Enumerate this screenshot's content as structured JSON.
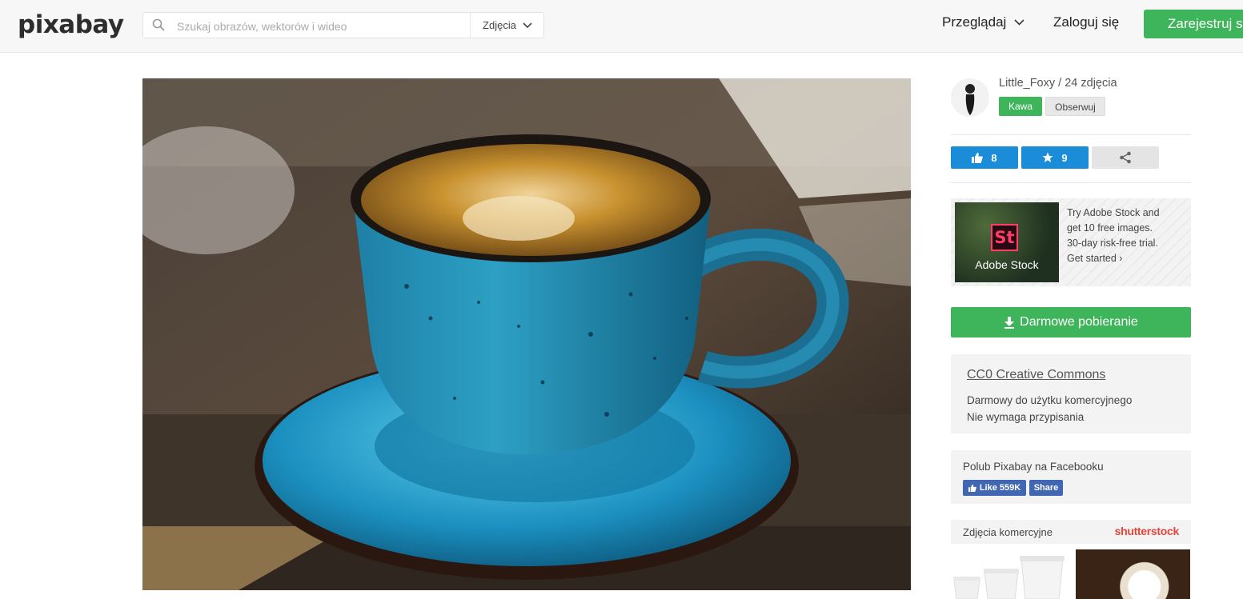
{
  "header": {
    "logo": "pixabay",
    "search_placeholder": "Szukaj obrazów, wektorów i wideo",
    "search_type": "Zdjęcia",
    "browse": "Przeglądaj",
    "login": "Zaloguj się",
    "signup": "Zarejestruj się"
  },
  "photo": {
    "subject": "Blue ceramic cup of coffee on saucer"
  },
  "author": {
    "name": "Little_Foxy",
    "count_text": "24 zdjęcia",
    "tag": "Kawa",
    "follow": "Obserwuj"
  },
  "stats": {
    "likes": "8",
    "favorites": "9"
  },
  "ad": {
    "logo_text": "St",
    "brand": "Adobe Stock",
    "line1": "Try Adobe Stock and",
    "line2": "get 10 free images.",
    "line3": "30-day risk-free trial.",
    "cta": "Get started ›"
  },
  "download": {
    "label": "Darmowe pobieranie"
  },
  "license": {
    "title": "CC0 Creative Commons",
    "line1": "Darmowy do użytku komercyjnego",
    "line2": "Nie wymaga przypisania"
  },
  "facebook": {
    "title": "Polub Pixabay na Facebooku",
    "like": "Like 559K",
    "share": "Share"
  },
  "stock": {
    "label": "Zdjęcia komercyjne",
    "brand": "shutterstock"
  },
  "colors": {
    "green": "#3eb55a",
    "blue": "#1a8cd8",
    "facebook": "#4267b2"
  }
}
